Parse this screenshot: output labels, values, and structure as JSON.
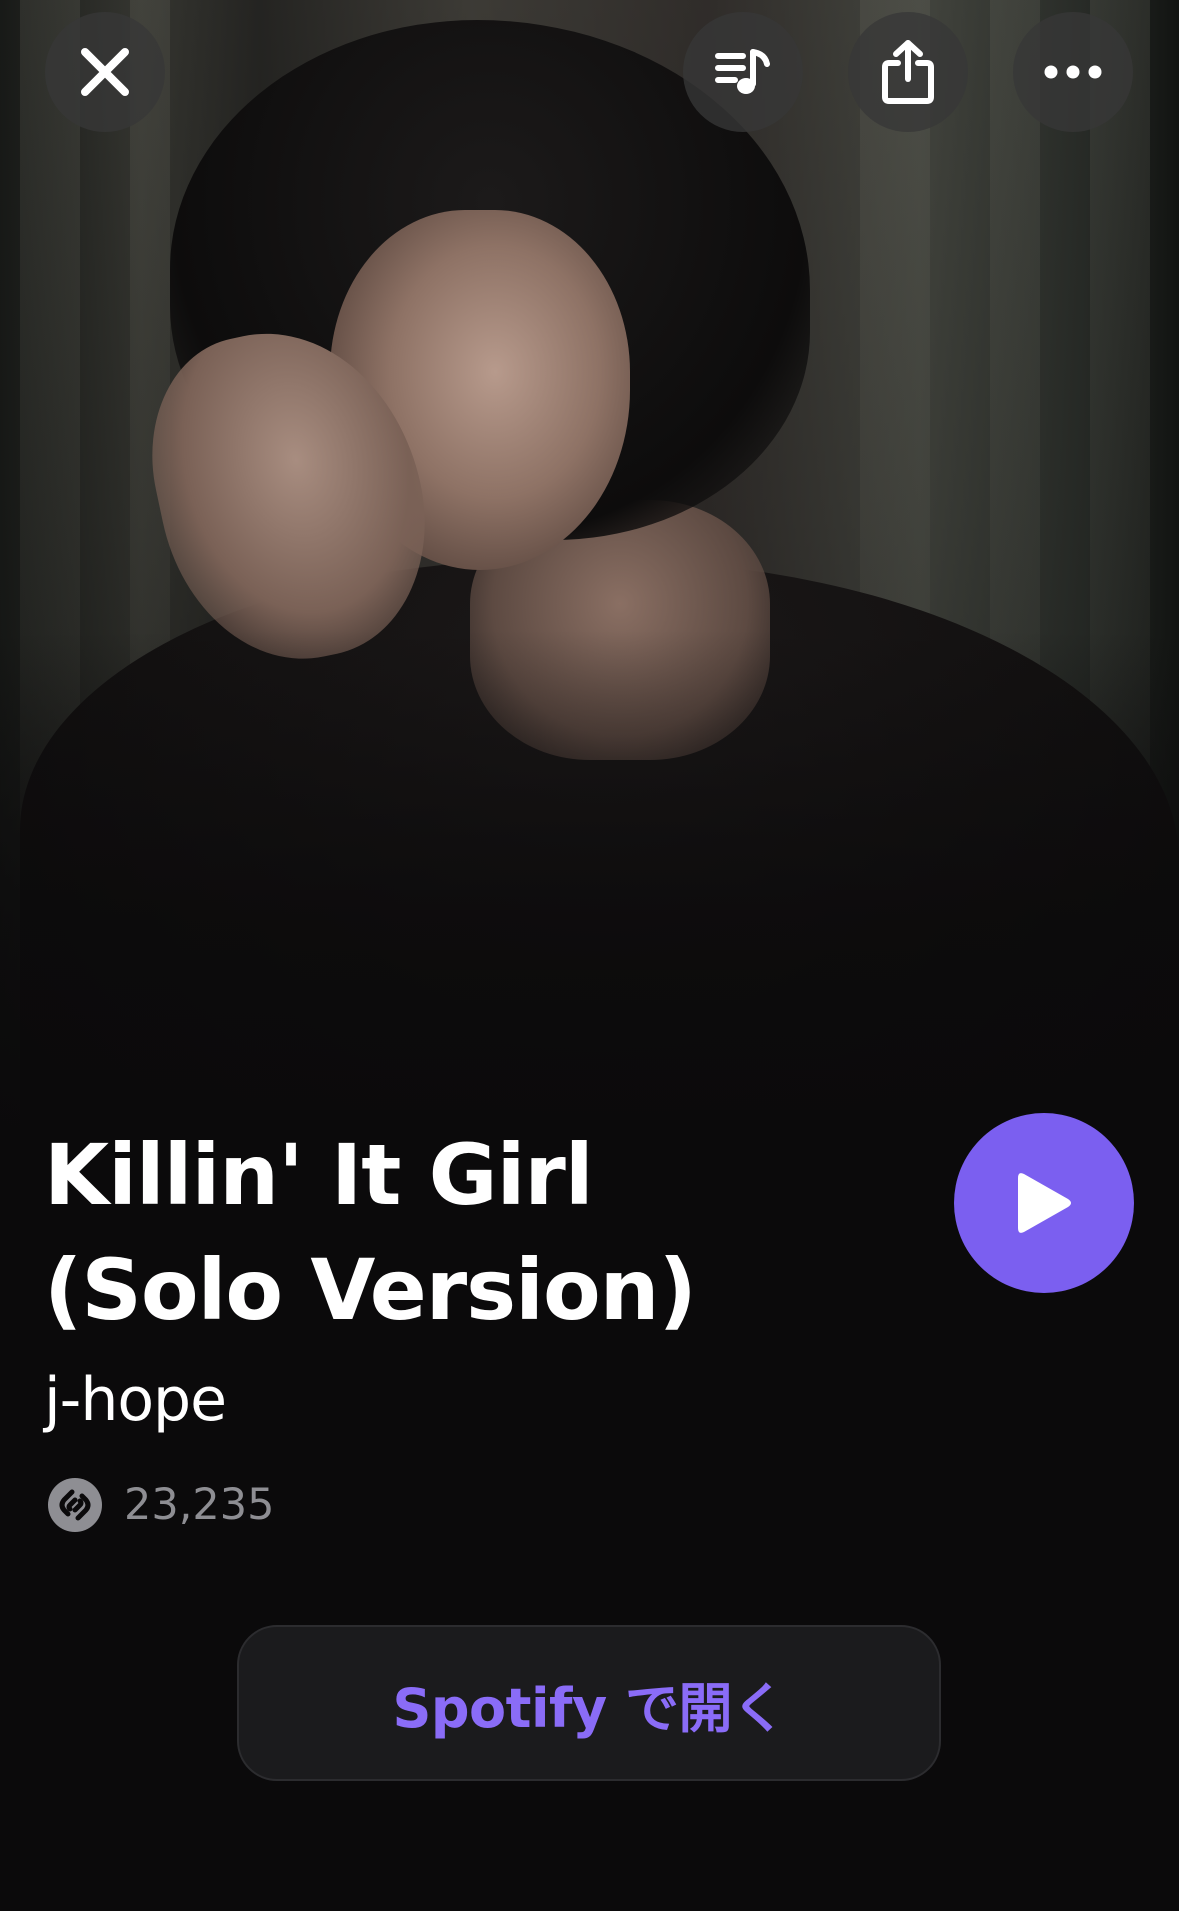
{
  "track": {
    "title_line1": "Killin' It Girl",
    "title_line2": "(Solo Version)",
    "artist": "j-hope",
    "shazam_count": "23,235"
  },
  "actions": {
    "open_label": "Spotify で開く"
  },
  "icons": {
    "close": "close-icon",
    "queue": "music-queue-icon",
    "share": "share-icon",
    "more": "more-icon",
    "play": "play-icon",
    "shazam": "shazam-icon"
  },
  "colors": {
    "accent": "#7b5ff0",
    "accent_text": "#8a6cf7",
    "background": "#0b0a0b",
    "muted_text": "#8e8e93"
  }
}
